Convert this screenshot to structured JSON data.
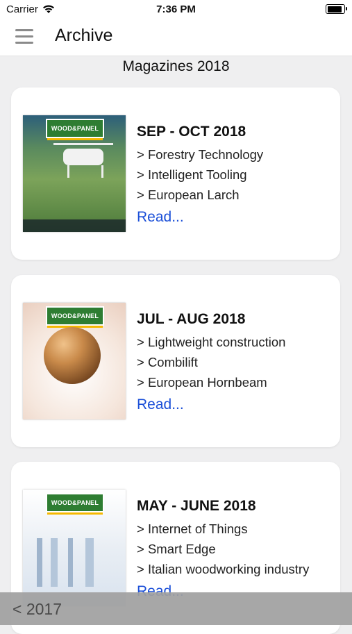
{
  "status_bar": {
    "carrier": "Carrier",
    "time": "7:36 PM",
    "wifi_icon": "wifi-icon",
    "battery_icon": "battery-icon"
  },
  "nav": {
    "menu_icon": "hamburger-menu-icon",
    "title": "Archive"
  },
  "section_title": "Magazines 2018",
  "issues": [
    {
      "title": "SEP - OCT 2018",
      "topics": [
        "> Forestry Technology",
        "> Intelligent Tooling",
        "> European Larch"
      ],
      "read_label": "Read...",
      "cover_logo": "WOOD&PANEL"
    },
    {
      "title": "JUL - AUG 2018",
      "topics": [
        "> Lightweight construction",
        "> Combilift",
        "> European Hornbeam"
      ],
      "read_label": "Read...",
      "cover_logo": "WOOD&PANEL"
    },
    {
      "title": "MAY - JUNE 2018",
      "topics": [
        "> Internet of Things",
        "> Smart Edge",
        "> Italian woodworking industry"
      ],
      "read_label": "Read...",
      "cover_logo": "WOOD&PANEL"
    }
  ],
  "bottom_bar": {
    "prev_label": "< 2017"
  },
  "colors": {
    "link": "#1b4fd8",
    "background": "#efeff0",
    "bottom_bar": "#a0a0a0"
  }
}
